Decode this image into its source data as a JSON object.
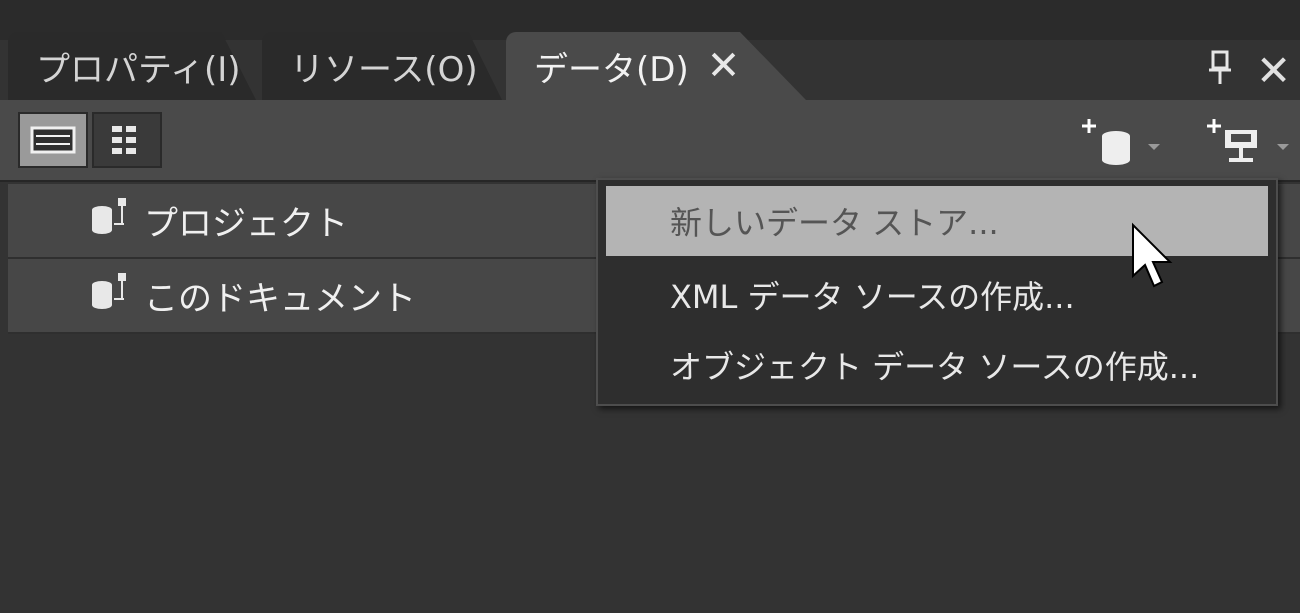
{
  "tabs": [
    {
      "label": "プロパティ(I)"
    },
    {
      "label": "リソース(O)"
    },
    {
      "label": "データ(D)",
      "close": "✕"
    }
  ],
  "panel": {
    "pin": "📌",
    "close": "✕"
  },
  "toolbar": {
    "list_view_icon": "list-view-icon",
    "grid_view_icon": "grid-view-icon",
    "add_datastore_icon": "add-datastore-icon",
    "add_datasource_icon": "add-datasource-icon"
  },
  "data_list": [
    {
      "label": "プロジェクト"
    },
    {
      "label": "このドキュメント"
    }
  ],
  "menu": [
    {
      "label": "新しいデータ ストア..."
    },
    {
      "label": "XML データ ソースの作成..."
    },
    {
      "label": "オブジェクト データ ソースの作成..."
    }
  ],
  "colors": {
    "menu_highlight": "#b4b4b4",
    "active_tab": "#4a4a4a",
    "background": "#333333"
  }
}
